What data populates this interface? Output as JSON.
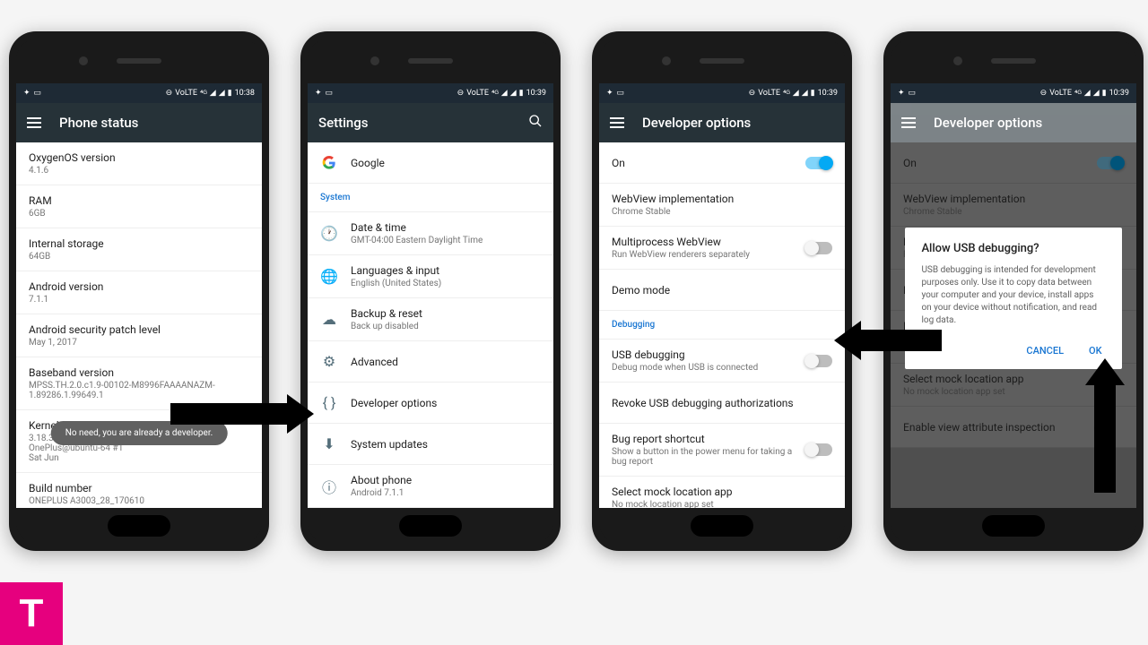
{
  "status": {
    "time1": "10:38",
    "time2": "10:39",
    "volte": "VoLTE",
    "net": "4G"
  },
  "p1": {
    "title": "Phone status",
    "items": [
      {
        "label": "OxygenOS version",
        "sub": "4.1.6"
      },
      {
        "label": "RAM",
        "sub": "6GB"
      },
      {
        "label": "Internal storage",
        "sub": "64GB"
      },
      {
        "label": "Android version",
        "sub": "7.1.1"
      },
      {
        "label": "Android security patch level",
        "sub": "May 1, 2017"
      },
      {
        "label": "Baseband version",
        "sub": "MPSS.TH.2.0.c1.9-00102-M8996FAAAANAZM-1.89286.1.99649.1"
      },
      {
        "label": "Kernel version",
        "sub": "3.18.31-perf+\nOnePlus@ubuntu-64 #1\nSat Jun"
      },
      {
        "label": "Build number",
        "sub": "ONEPLUS A3003_28_170610"
      }
    ],
    "toast": "No need, you are already a developer."
  },
  "p2": {
    "title": "Settings",
    "google": "Google",
    "section": "System",
    "items": [
      {
        "label": "Date & time",
        "sub": "GMT-04:00 Eastern Daylight Time"
      },
      {
        "label": "Languages & input",
        "sub": "English (United States)"
      },
      {
        "label": "Backup & reset",
        "sub": "Back up disabled"
      },
      {
        "label": "Advanced",
        "sub": ""
      },
      {
        "label": "Developer options",
        "sub": ""
      },
      {
        "label": "System updates",
        "sub": ""
      },
      {
        "label": "About phone",
        "sub": "Android 7.1.1"
      }
    ]
  },
  "p3": {
    "title": "Developer options",
    "on": "On",
    "items": [
      {
        "label": "WebView implementation",
        "sub": "Chrome Stable"
      },
      {
        "label": "Multiprocess WebView",
        "sub": "Run WebView renderers separately",
        "toggle": false
      },
      {
        "label": "Demo mode",
        "sub": ""
      }
    ],
    "section": "Debugging",
    "debug": [
      {
        "label": "USB debugging",
        "sub": "Debug mode when USB is connected",
        "toggle": false
      },
      {
        "label": "Revoke USB debugging authorizations",
        "sub": ""
      },
      {
        "label": "Bug report shortcut",
        "sub": "Show a button in the power menu for taking a bug report",
        "toggle": false
      },
      {
        "label": "Select mock location app",
        "sub": "No mock location app set"
      },
      {
        "label": "Enable view attribute inspection",
        "sub": "",
        "toggle": false
      }
    ]
  },
  "p4": {
    "dialog": {
      "title": "Allow USB debugging?",
      "body": "USB debugging is intended for development purposes only. Use it to copy data between your computer and your device, install apps on your device without notification, and read log data.",
      "cancel": "CANCEL",
      "ok": "OK"
    }
  }
}
